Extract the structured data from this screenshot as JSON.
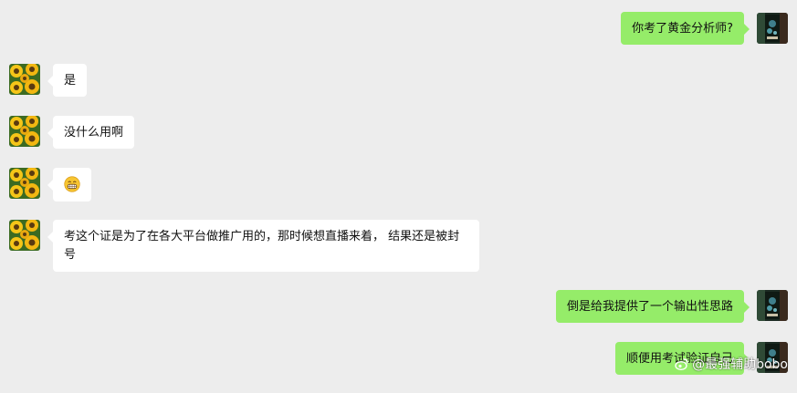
{
  "messages": [
    {
      "side": "out",
      "text": "你考了黄金分析师?"
    },
    {
      "side": "in",
      "text": "是"
    },
    {
      "side": "in",
      "text": "没什么用啊"
    },
    {
      "side": "in",
      "text": "",
      "emoji": "grinning-face-emoji"
    },
    {
      "side": "in",
      "text": "考这个证是为了在各大平台做推广用的，那时候想直播来着， 结果还是被封号"
    },
    {
      "side": "out",
      "text": "倒是给我提供了一个输出性思路"
    },
    {
      "side": "out",
      "text": "顺便用考试验证自己"
    }
  ],
  "watermark": {
    "text": "@最强辅助bobo",
    "icon": "weibo-icon"
  },
  "colors": {
    "background": "#ededed",
    "incoming_bubble": "#ffffff",
    "outgoing_bubble": "#95ec69"
  }
}
